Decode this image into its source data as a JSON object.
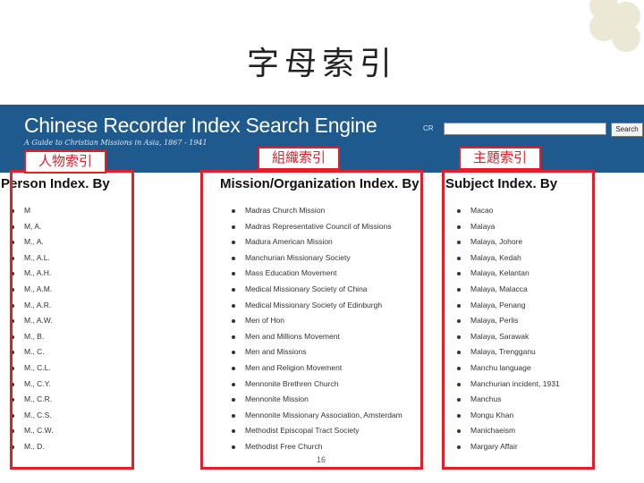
{
  "slide_title": "字母索引",
  "banner": {
    "title": "Chinese Recorder Index Search Engine",
    "subtitle": "A Guide to Christian Missions in Asia, 1867 - 1941",
    "search_label": "CR",
    "search_value": "",
    "search_button": "Search"
  },
  "annotations": {
    "person": "人物索引",
    "organization": "組織索引",
    "subject": "主題索引"
  },
  "columns": {
    "person": {
      "header": "Person Index. By",
      "items": [
        "M",
        "M, A.",
        "M., A.",
        "M., A.L.",
        "M., A.H.",
        "M., A.M.",
        "M., A.R.",
        "M., A.W.",
        "M., B.",
        "M., C.",
        "M., C.L.",
        "M., C.Y.",
        "M., C.R.",
        "M., C.S.",
        "M., C.W.",
        "M., D."
      ]
    },
    "organization": {
      "header": "Mission/Organization Index. By",
      "items": [
        "Madras Church Mission",
        "Madras Representative Council of Missions",
        "Madura American Mission",
        "Manchurian Missionary Society",
        "Mass Education Movement",
        "Medical Missionary Society of China",
        "Medical Missionary Society of Edinburgh",
        "Men of Hon",
        "Men and Millions Movement",
        "Men and Missions",
        "Men and Religion Movement",
        "Mennonite Brethren Church",
        "Mennonite Mission",
        "Mennonite Missionary Association, Amsterdam",
        "Methodist Episcopal Tract Society",
        "Methodist Free Church"
      ]
    },
    "subject": {
      "header": "Subject Index. By",
      "items": [
        "Macao",
        "Malaya",
        "Malaya, Johore",
        "Malaya, Kedah",
        "Malaya, Kelantan",
        "Malaya, Malacca",
        "Malaya, Penang",
        "Malaya, Perlis",
        "Malaya, Sarawak",
        "Malaya, Trengganu",
        "Manchu language",
        "Manchurian incident, 1931",
        "Manchus",
        "Mongu Khan",
        "Manichaeism",
        "Margary Affair"
      ]
    }
  },
  "page_number": "16",
  "colors": {
    "banner": "#1e5a8e",
    "annotation": "#e3202a",
    "decor": "#ece8d6"
  }
}
